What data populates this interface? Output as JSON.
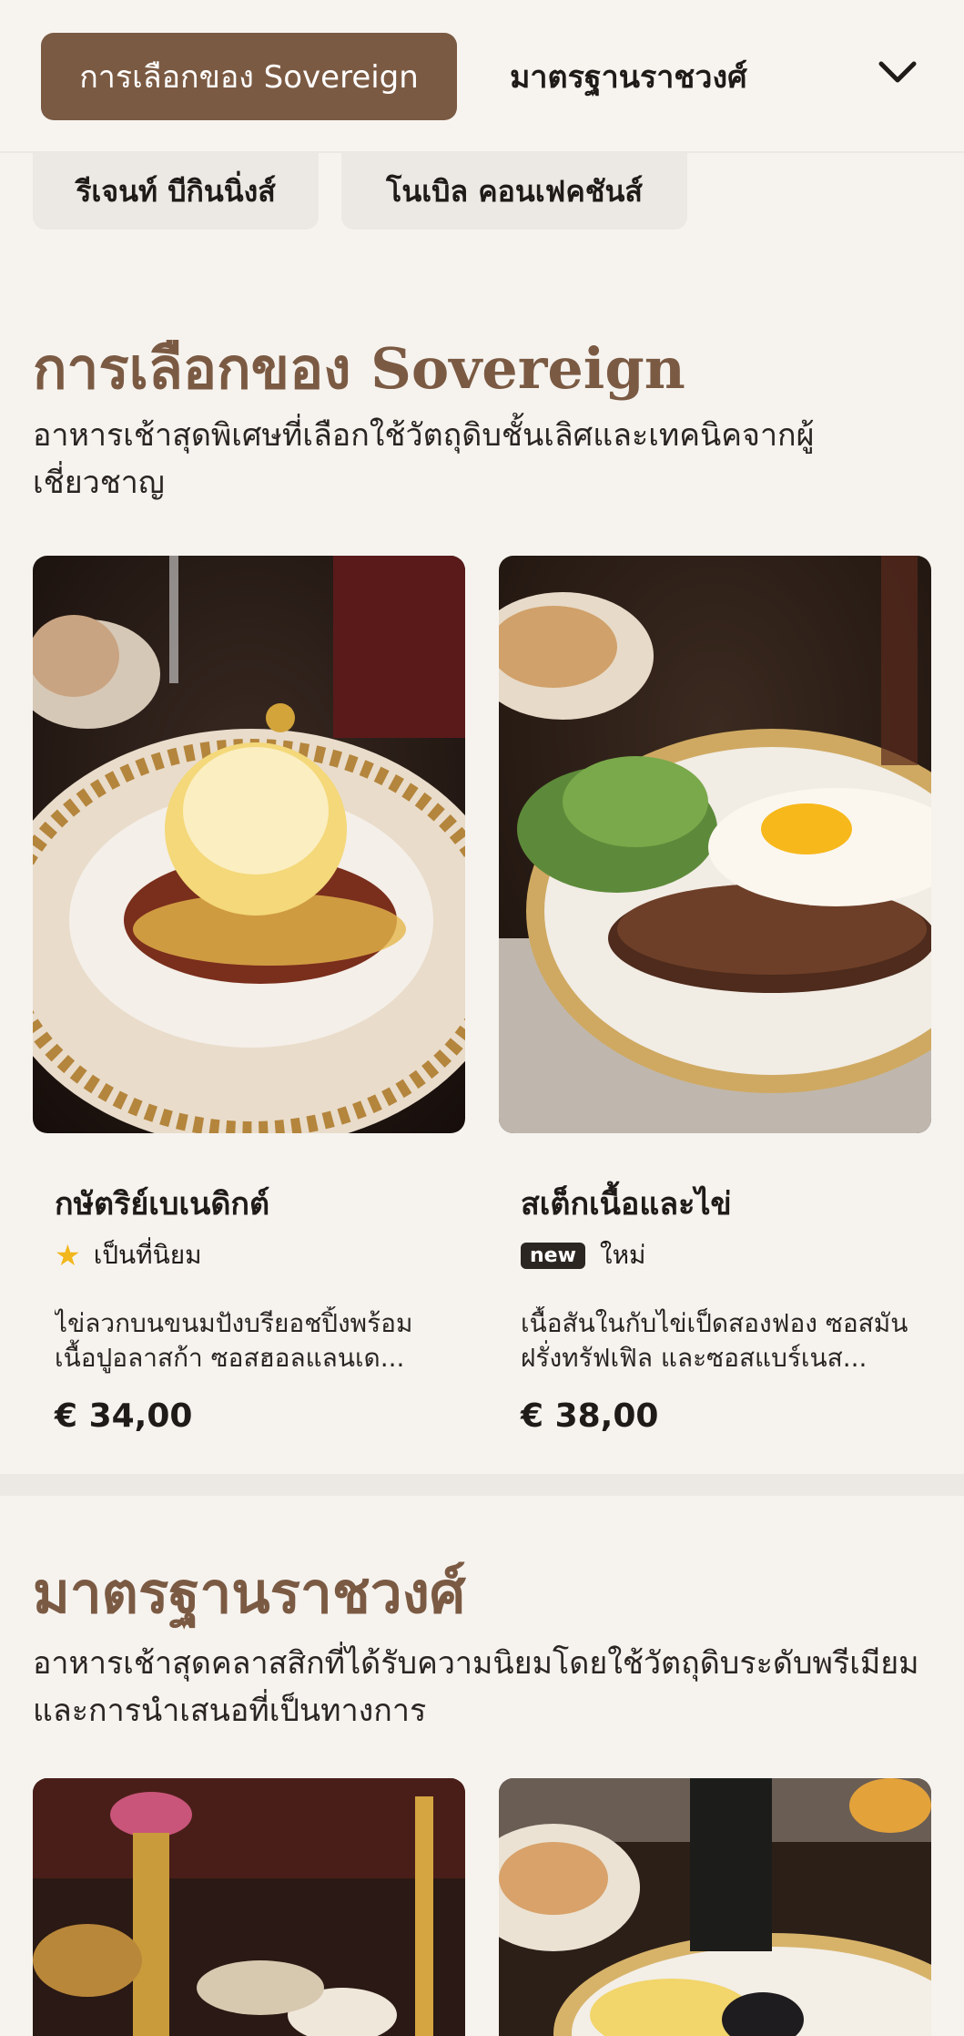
{
  "nav": {
    "active_tab": "การเลือกของ Sovereign",
    "second_tab": "มาตรฐานราชวงศ์",
    "sub_tabs": [
      "รีเจนท์ บีกินนิ่งส์",
      "โนเบิล คอนเฟคชันส์"
    ],
    "expand_icon": "chevron-down-icon"
  },
  "sections": [
    {
      "title": "การเลือกของ Sovereign",
      "description": "อาหารเช้าสุดพิเศษที่เลือกใช้วัตถุดิบชั้นเลิศและเทคนิคจากผู้เชี่ยวชาญ",
      "items": [
        {
          "name": "กษัตริย์เบเนดิกต์",
          "tag_icon": "star-icon",
          "tag": "เป็นที่นิยม",
          "description": "ไข่ลวกบนขนมปังบรียอชปิ้งพร้อมเนื้อปูอลาสก้า ซอสฮอลแลนเด...",
          "price": "€ 34,00"
        },
        {
          "name": "สเต็กเนื้อและไข่",
          "badge": "new",
          "tag": "ใหม่",
          "description": "เนื้อสันในกับไข่เป็ดสองฟอง ซอสมันฝรั่งทรัฟเฟิล และซอสแบร์เนส...",
          "price": "€ 38,00"
        }
      ]
    },
    {
      "title": "มาตรฐานราชวงศ์",
      "description": "อาหารเช้าสุดคลาสสิกที่ได้รับความนิยมโดยใช้วัตถุดิบระดับพรีเมียมและการนำเสนอที่เป็นทางการ"
    }
  ],
  "colors": {
    "accent": "#7b5a43",
    "background": "#f6f3ef",
    "star": "#f2b71c"
  }
}
